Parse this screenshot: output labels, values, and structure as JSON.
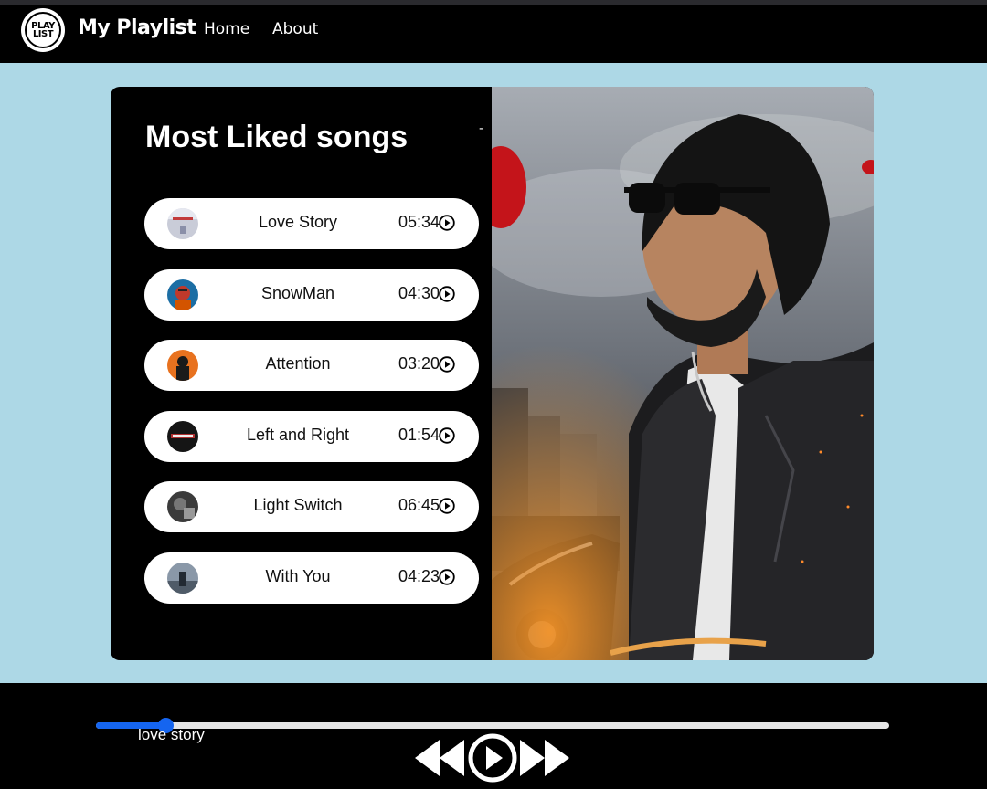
{
  "brand": {
    "logo_text_top": "PLAY",
    "logo_text_bottom": "LIST",
    "title": "My Playlist"
  },
  "nav": {
    "links": [
      "Home",
      "About"
    ]
  },
  "card": {
    "title": "Most Liked songs",
    "dash": "-",
    "songs": [
      {
        "name": "Love Story",
        "duration": "05:34"
      },
      {
        "name": "SnowMan",
        "duration": "04:30"
      },
      {
        "name": "Attention",
        "duration": "03:20"
      },
      {
        "name": "Left and Right",
        "duration": "01:54"
      },
      {
        "name": "Light Switch",
        "duration": "06:45"
      },
      {
        "name": "With You",
        "duration": "04:23"
      }
    ]
  },
  "player": {
    "now_playing": "love story",
    "progress": 0.088
  },
  "colors": {
    "page_bg": "#add8e6",
    "accent": "#1565f0"
  },
  "icons": {
    "song_play": "play-circle-icon",
    "previous": "previous-icon",
    "master_play": "play-circle-icon",
    "next": "next-icon"
  }
}
